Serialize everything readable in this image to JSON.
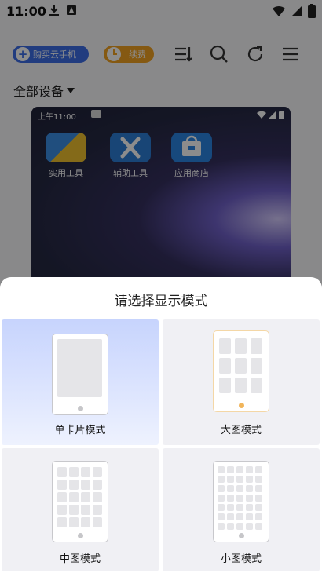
{
  "status_bar": {
    "time": "11:00"
  },
  "toolbar": {
    "buy_label": "购买云手机",
    "renew_label": "续费",
    "icons": [
      "sort-icon",
      "search-icon",
      "refresh-icon",
      "menu-icon"
    ]
  },
  "device_filter": {
    "label": "全部设备"
  },
  "phone_preview": {
    "time": "上午11:00",
    "apps": [
      {
        "label": "实用工具",
        "icon": "tools-icon"
      },
      {
        "label": "辅助工具",
        "icon": "assist-icon"
      },
      {
        "label": "应用商店",
        "icon": "store-icon"
      }
    ]
  },
  "sheet": {
    "title": "请选择显示模式",
    "modes": [
      {
        "label": "单卡片模式",
        "selected": true
      },
      {
        "label": "大图模式",
        "selected": false
      },
      {
        "label": "中图模式",
        "selected": false
      },
      {
        "label": "小图模式",
        "selected": false
      }
    ]
  },
  "colors": {
    "accent_blue": "#3c6de8",
    "accent_orange": "#f3a321",
    "selected_card": "#c7d4fd"
  }
}
